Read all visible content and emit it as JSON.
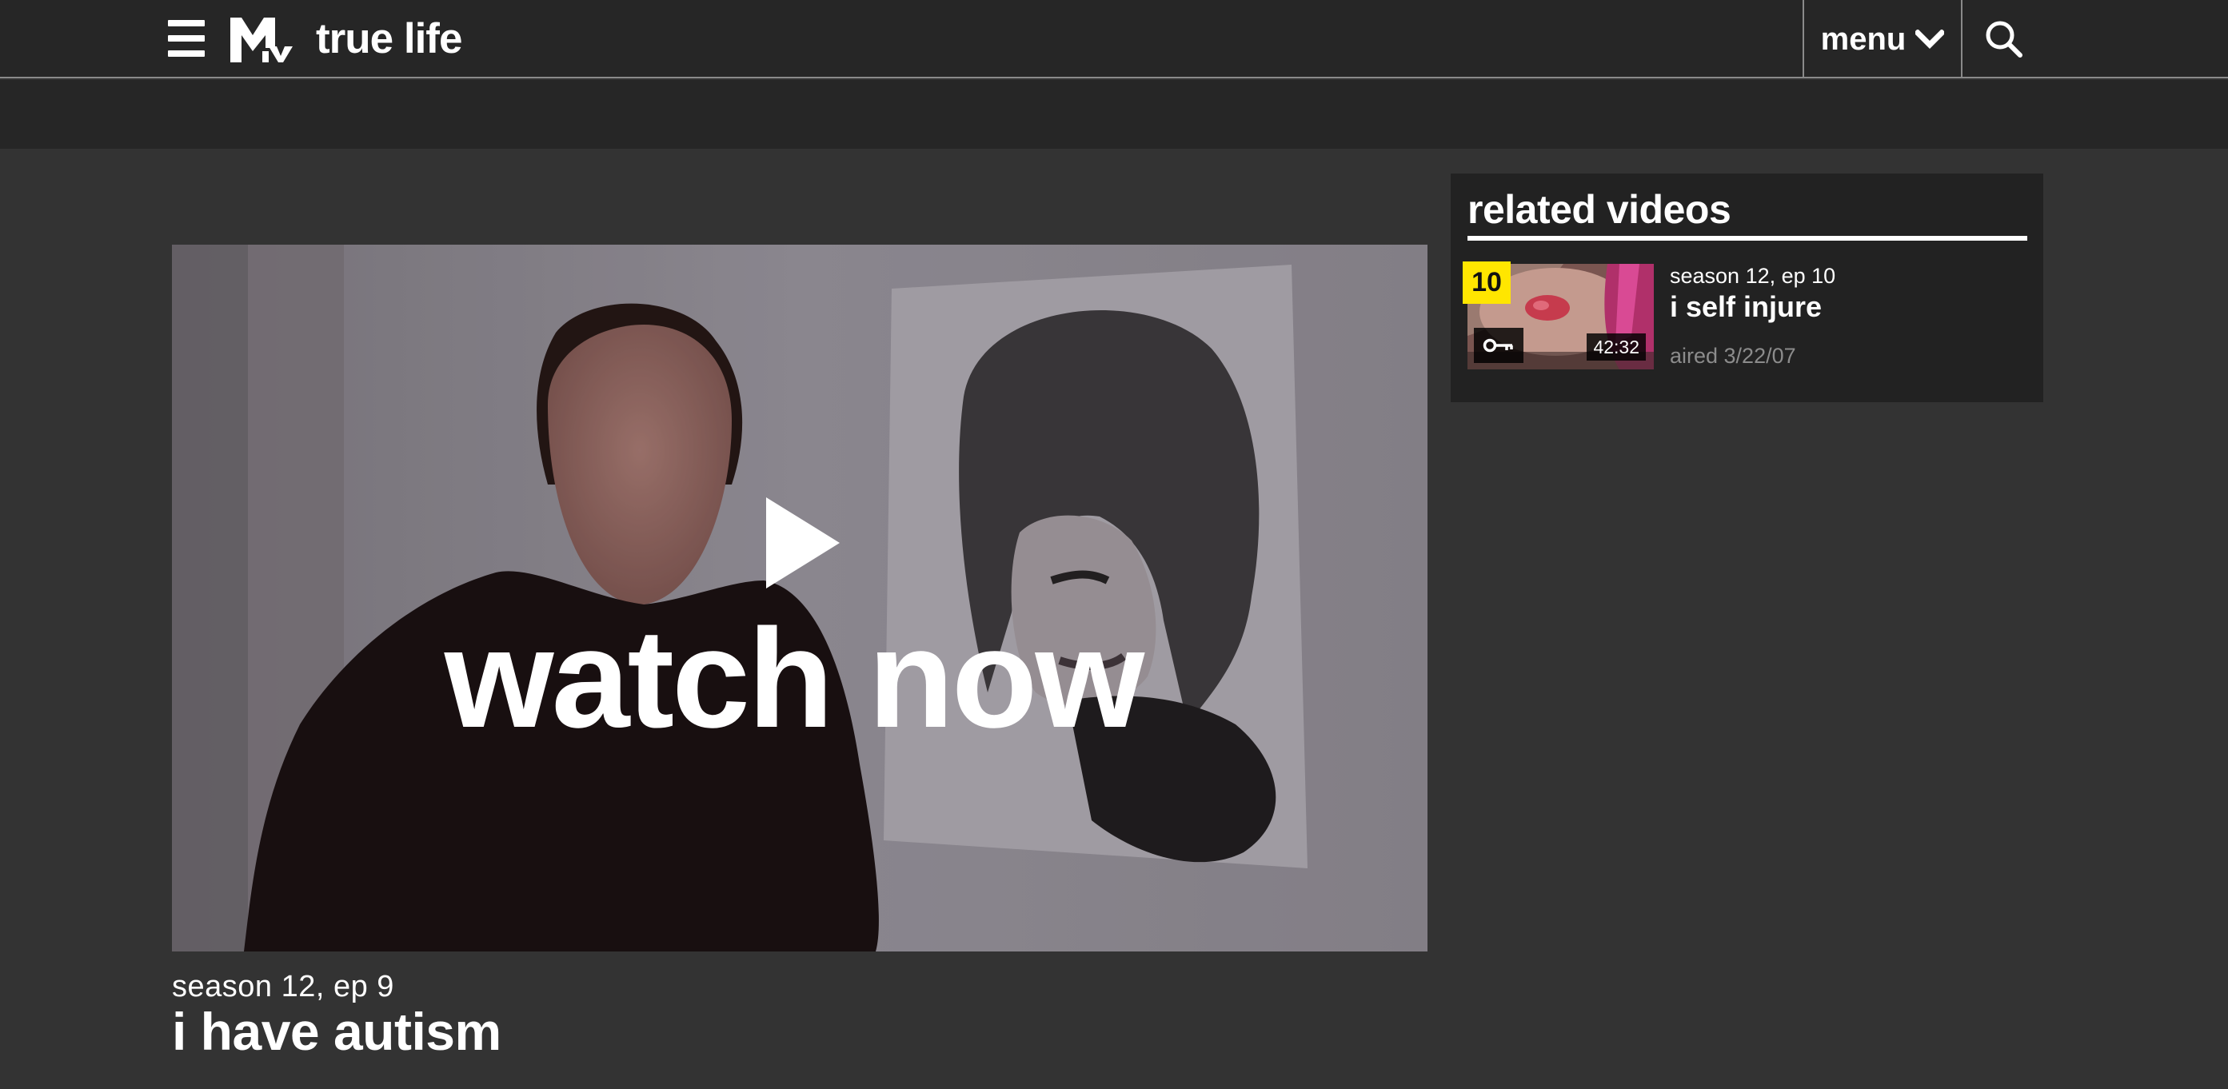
{
  "header": {
    "logo_text": "MTV",
    "show_title": "true life",
    "menu_label": "menu"
  },
  "player": {
    "overlay_text": "watch now",
    "season_episode": "season 12, ep 9",
    "episode_title": "i have autism"
  },
  "related": {
    "heading": "related videos",
    "items": [
      {
        "badge": "10",
        "duration": "42:32",
        "season_episode": "season 12, ep 10",
        "title": "i self injure",
        "aired": "aired 3/22/07"
      }
    ]
  },
  "colors": {
    "header_bg": "#262626",
    "page_bg": "#333333",
    "badge_yellow": "#ffe600",
    "muted_text": "#8c8c8c"
  }
}
